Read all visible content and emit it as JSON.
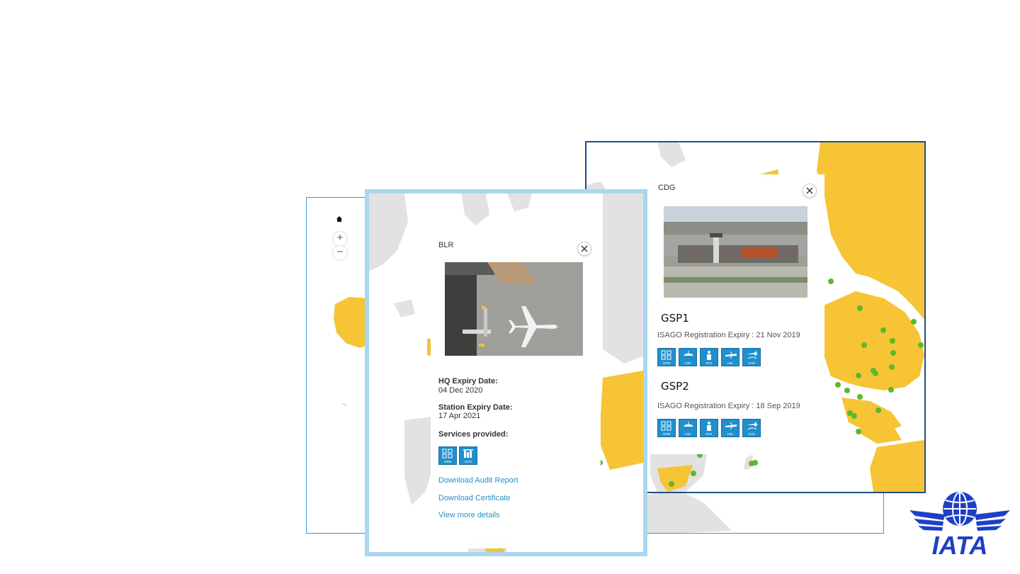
{
  "back_map": {
    "controls": {
      "home_icon": "home-icon",
      "zoom_in": "+",
      "zoom_out": "−"
    }
  },
  "blr_popup": {
    "title": "BLR",
    "close_icon": "close-icon",
    "hq_expiry_label": "HQ Expiry Date:",
    "hq_expiry_value": "04 Dec 2020",
    "station_expiry_label": "Station Expiry Date:",
    "station_expiry_value": "17 Apr 2021",
    "services_label": "Services provided:",
    "services": [
      {
        "code": "ORM",
        "icon": "orm-icon"
      },
      {
        "code": "CGR",
        "icon": "cargo-icon"
      }
    ],
    "links": {
      "audit_report": "Download Audit Report",
      "certificate": "Download Certificate",
      "more_details": "View more details"
    }
  },
  "cdg_popup": {
    "title": "CDG",
    "close_icon": "close-icon",
    "providers": [
      {
        "name": "GSP1",
        "expiry": "ISAGO Registration Expiry : 21 Nov 2019",
        "services": [
          "ORM",
          "LOD",
          "PAX",
          "HDL",
          "ACM"
        ]
      },
      {
        "name": "GSP2",
        "expiry": "ISAGO Registration Expiry : 18 Sep 2019",
        "services": [
          "ORM",
          "LOD",
          "PAX",
          "HDL",
          "ACM"
        ]
      }
    ]
  },
  "logo": {
    "text": "IATA",
    "color": "#1e3fc7"
  },
  "colors": {
    "map_highlight": "#f6c434",
    "map_land": "#e2e2e2",
    "station_dot": "#5cb82e",
    "service_blue": "#1f8fcd",
    "link_blue": "#2b8fc9"
  }
}
